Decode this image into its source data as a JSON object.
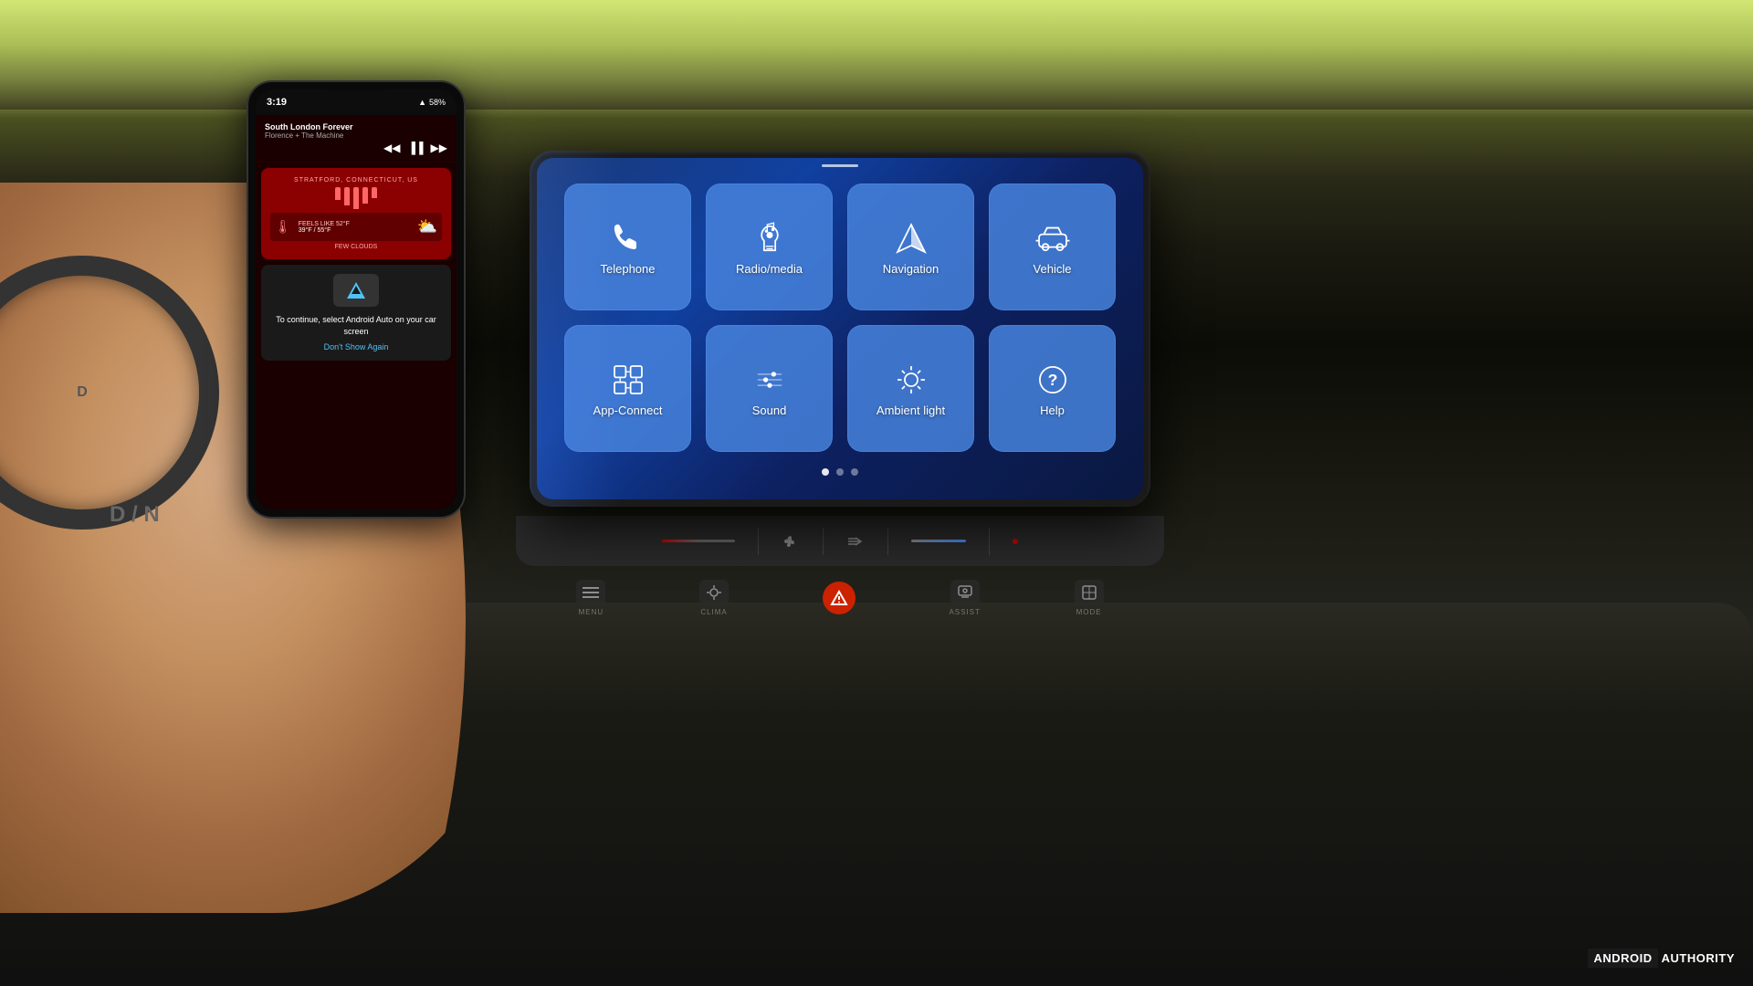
{
  "scene": {
    "title": "Android Auto Car Screen"
  },
  "phone": {
    "status_bar": {
      "time": "3:19",
      "battery": "58%",
      "icons": "▲ ⊞ ◈ ▲"
    },
    "music": {
      "title": "South London Forever",
      "artist": "Florence + The Machine",
      "controls": [
        "◀◀",
        "▐▐",
        "▶▶"
      ]
    },
    "weather": {
      "location": "STRATFORD, CONNECTICUT, US",
      "feels_like": "FEELS LIKE 52°F",
      "temps": "39°F / 55°F",
      "description": "FEW CLOUDS"
    },
    "android_auto": {
      "prompt": "To continue, select Android Auto on your car screen",
      "dismiss": "Don't Show Again"
    }
  },
  "car_screen": {
    "page_indicator": {
      "current": 0,
      "total": 3
    },
    "apps": [
      {
        "id": "telephone",
        "label": "Telephone",
        "icon": "telephone"
      },
      {
        "id": "radio-media",
        "label": "Radio/media",
        "icon": "music"
      },
      {
        "id": "navigation",
        "label": "Navigation",
        "icon": "navigation"
      },
      {
        "id": "vehicle",
        "label": "Vehicle",
        "icon": "vehicle"
      },
      {
        "id": "app-connect",
        "label": "App-Connect",
        "icon": "app-connect"
      },
      {
        "id": "sound",
        "label": "Sound",
        "icon": "sound"
      },
      {
        "id": "ambient-light",
        "label": "Ambient light",
        "icon": "ambient"
      },
      {
        "id": "help",
        "label": "Help",
        "icon": "help"
      }
    ],
    "hard_buttons": [
      {
        "id": "menu",
        "label": "MENU",
        "icon": "☰"
      },
      {
        "id": "clima",
        "label": "CLIMA",
        "icon": "❄"
      },
      {
        "id": "hazard",
        "label": "",
        "icon": "▲"
      },
      {
        "id": "assist",
        "label": "ASSIST",
        "icon": "◎"
      },
      {
        "id": "mode",
        "label": "MODE",
        "icon": "⊕"
      }
    ]
  },
  "watermark": {
    "android": "ANDROID",
    "authority": "AUTHORITY"
  }
}
